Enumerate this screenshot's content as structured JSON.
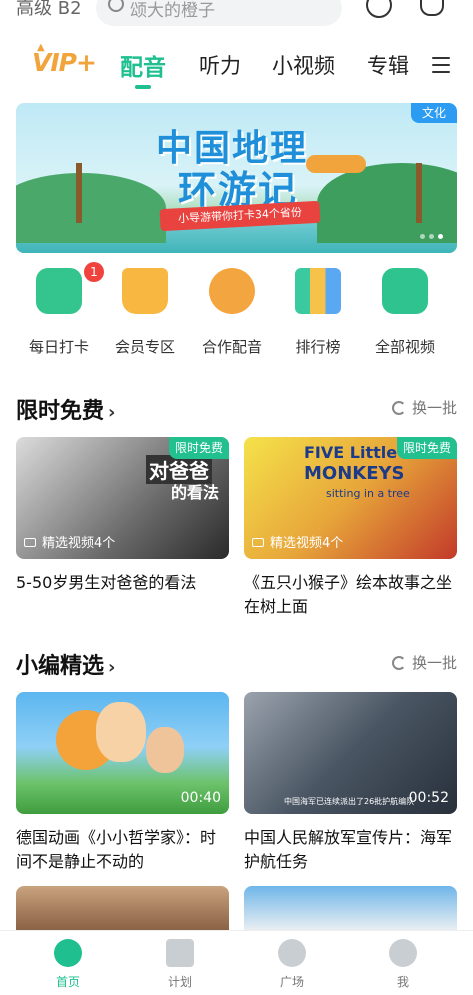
{
  "header": {
    "level": "高级 B2",
    "search_placeholder": "颂大的橙子"
  },
  "tabs": {
    "vip": "VIP+",
    "items": [
      "配音",
      "听力",
      "小视频",
      "专辑"
    ],
    "active": "配音"
  },
  "banner": {
    "title_line1": "中国地理",
    "title_line2": "环游记",
    "ribbon": "小导游带你打卡34个省份",
    "badge": "文化"
  },
  "quick": {
    "items": [
      {
        "label": "每日打卡",
        "icon": "calendar-check-icon",
        "badge": "1"
      },
      {
        "label": "会员专区",
        "icon": "crown-icon"
      },
      {
        "label": "合作配音",
        "icon": "microphone-icon"
      },
      {
        "label": "排行榜",
        "icon": "podium-icon"
      },
      {
        "label": "全部视频",
        "icon": "video-target-icon"
      }
    ]
  },
  "section1": {
    "title": "限时免费",
    "refresh": "换一批",
    "cards": [
      {
        "tag": "限时免费",
        "count": "精选视频4个",
        "overlay1": "对爸爸",
        "overlay2": "的看法",
        "title": "5-50岁男生对爸爸的看法"
      },
      {
        "tag": "限时免费",
        "count": "精选视频4个",
        "overlay1": "FIVE Little",
        "overlay2": "MONKEYS",
        "overlay3": "sitting in a tree",
        "title": "《五只小猴子》绘本故事之坐在树上面"
      }
    ]
  },
  "section2": {
    "title": "小编精选",
    "refresh": "换一批",
    "cards": [
      {
        "duration": "00:40",
        "title": "德国动画《小小哲学家》：时间不是静止不动的"
      },
      {
        "duration": "00:52",
        "caption": "中国海军已连续派出了26批护航编队",
        "title": "中国人民解放军宣传片：海军护航任务"
      }
    ]
  },
  "bottomnav": {
    "items": [
      {
        "label": "首页",
        "icon": "home-play-icon",
        "active": true
      },
      {
        "label": "计划",
        "icon": "book-icon"
      },
      {
        "label": "广场",
        "icon": "chat-bubbles-icon"
      },
      {
        "label": "我",
        "icon": "profile-icon"
      }
    ]
  },
  "colors": {
    "accent": "#1fbf8f",
    "vip": "#f2a43c",
    "badge_red": "#f0433d"
  }
}
